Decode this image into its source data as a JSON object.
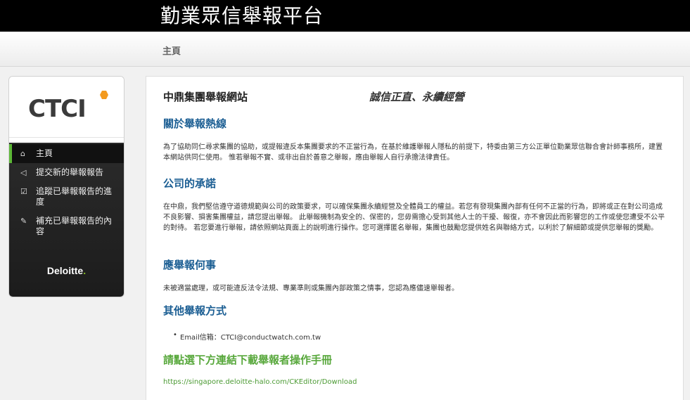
{
  "header": {
    "site_title": "勤業眾信舉報平台"
  },
  "breadcrumb": {
    "current": "主頁"
  },
  "sidebar": {
    "logo_text": "CTCI",
    "items": [
      {
        "icon": "home-icon",
        "label": "主頁",
        "active": true
      },
      {
        "icon": "megaphone-icon",
        "label": "提交新的舉報報告"
      },
      {
        "icon": "checkbox-icon",
        "label": "追蹤已舉報報告的進度"
      },
      {
        "icon": "edit-icon",
        "label": "補充已舉報報告的內容"
      }
    ],
    "partner_logo": "Deloitte",
    "partner_logo_dot": "."
  },
  "main": {
    "org_title": "中鼎集團舉報網站",
    "motto": "誠信正直、永續經營",
    "sections": [
      {
        "heading": "關於舉報熱線",
        "body": "為了協助同仁尋求集團的協助，或提報違反本集團要求的不正當行為，在基於維護舉報人隱私的前提下，特委由第三方公正單位勤業眾信聯合會計師事務所，建置本網站供同仁使用。 惟若舉報不實、或非出自於善意之舉報，應由舉報人自行承擔法律責任。"
      },
      {
        "heading": "公司的承諾",
        "body": "在中鼎，我們堅信遵守道德規範與公司的政策要求，可以確保集團永續經營及全體員工的權益。若您有發現集團內部有任何不正當的行為，即將或正在對公司造成不良影響、損害集團權益，請您提出舉報。 此舉報機制為安全的、保密的，您毋需擔心受到其他人士的干擾、報復，亦不會因此而影響您的工作或使您遭受不公平的對待。 若您要進行舉報，請依照網站頁面上的說明進行操作。您可選擇匿名舉報，集團也鼓勵您提供姓名與聯絡方式，以利於了解細節或提供您舉報的獎勵。"
      },
      {
        "heading": "應舉報何事",
        "body": "未被適當處理，或可能違反法令法規、專業準則或集團內部政策之情事，您認為應儘速舉報者。"
      },
      {
        "heading": "其他舉報方式",
        "bullet": "Email信箱：CTCI@conductwatch.com.tw"
      },
      {
        "heading": "請點選下方連結下載舉報者操作手冊",
        "link": "https://singapore.deloitte-halo.com/CKEditor/Download"
      }
    ]
  },
  "colors": {
    "section_heading": "#1b5e93",
    "download_heading": "#58a83c",
    "active_marker": "#5db837",
    "ctci_accent": "#f39a1e",
    "deloitte_dot": "#86bc25"
  }
}
